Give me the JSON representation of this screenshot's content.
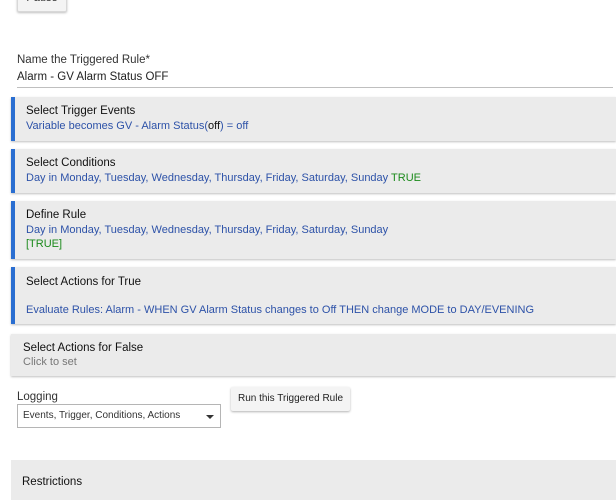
{
  "top_button": {
    "label": "Pause"
  },
  "name_field": {
    "label": "Name the Triggered Rule*",
    "value": "Alarm - GV Alarm Status OFF"
  },
  "trigger_events": {
    "title": "Select Trigger Events",
    "pre": "Variable becomes GV - Alarm Status(",
    "val": "off",
    "post": ") = off"
  },
  "conditions": {
    "title": "Select Conditions",
    "text": "Day in Monday, Tuesday, Wednesday, Thursday, Friday, Saturday, Sunday ",
    "result": "TRUE"
  },
  "define_rule": {
    "title": "Define Rule",
    "text": "Day in Monday, Tuesday, Wednesday, Thursday, Friday, Saturday, Sunday",
    "result": "[TRUE]"
  },
  "actions_true": {
    "title": "Select Actions for True",
    "text": "Evaluate Rules: Alarm - WHEN GV Alarm Status changes to Off THEN change MODE to DAY/EVENING"
  },
  "actions_false": {
    "title": "Select Actions for False",
    "hint": "Click to set"
  },
  "logging": {
    "label": "Logging",
    "value": "Events, Trigger, Conditions, Actions"
  },
  "run_button": {
    "label": "Run this Triggered Rule"
  },
  "restrictions": {
    "title": "Restrictions"
  },
  "colors": {
    "accent": "#2a6ed1",
    "link": "#2d52a8",
    "true": "#1b8a1b"
  }
}
